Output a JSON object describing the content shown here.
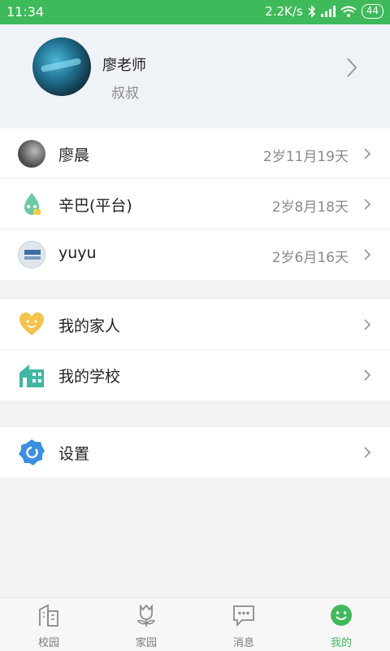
{
  "status_bar": {
    "time": "11:34",
    "network_speed": "2.2K/s",
    "battery": "44"
  },
  "profile": {
    "name": "廖老师",
    "role": "叔叔"
  },
  "children": [
    {
      "name": "廖晨",
      "age": "2岁11月19天"
    },
    {
      "name": "辛巴(平台)",
      "age": "2岁8月18天"
    },
    {
      "name": "yuyu",
      "age": "2岁6月16天"
    }
  ],
  "menu": {
    "family": "我的家人",
    "school": "我的学校"
  },
  "settings": {
    "label": "设置"
  },
  "tabbar": {
    "tabs": [
      {
        "label": "校园",
        "icon": "building-icon"
      },
      {
        "label": "家园",
        "icon": "flower-icon"
      },
      {
        "label": "消息",
        "icon": "chat-icon"
      },
      {
        "label": "我的",
        "icon": "smile-icon",
        "active": true
      }
    ]
  },
  "colors": {
    "accent": "#3fba5b",
    "family_icon": "#f5c24b",
    "school_icon": "#3fb8a2",
    "settings_icon": "#3b8fe0"
  }
}
